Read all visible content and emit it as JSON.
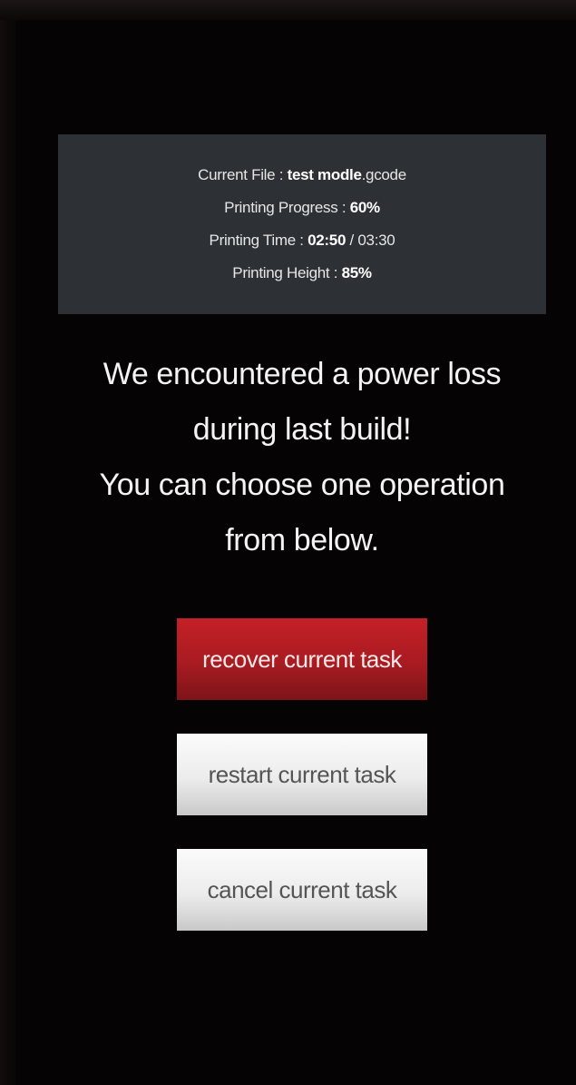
{
  "info": {
    "file_label": "Current File : ",
    "file_value": "test modle",
    "file_ext": ".gcode",
    "progress_label": "Printing Progress : ",
    "progress_value": "60%",
    "time_label": "Printing Time : ",
    "time_elapsed": "02:50",
    "time_sep": " / ",
    "time_total": "03:30",
    "height_label": "Printing Height : ",
    "height_value": "85%"
  },
  "message": {
    "line1": "We encountered a power loss",
    "line2": "during last build!",
    "line3": "You can choose one operation",
    "line4": "from below."
  },
  "buttons": {
    "recover": "recover current task",
    "restart": "restart current task",
    "cancel": "cancel current task"
  },
  "colors": {
    "background": "#050304",
    "info_panel": "#2d3135",
    "recover_button": "#b81e24",
    "secondary_button": "#ececec"
  }
}
